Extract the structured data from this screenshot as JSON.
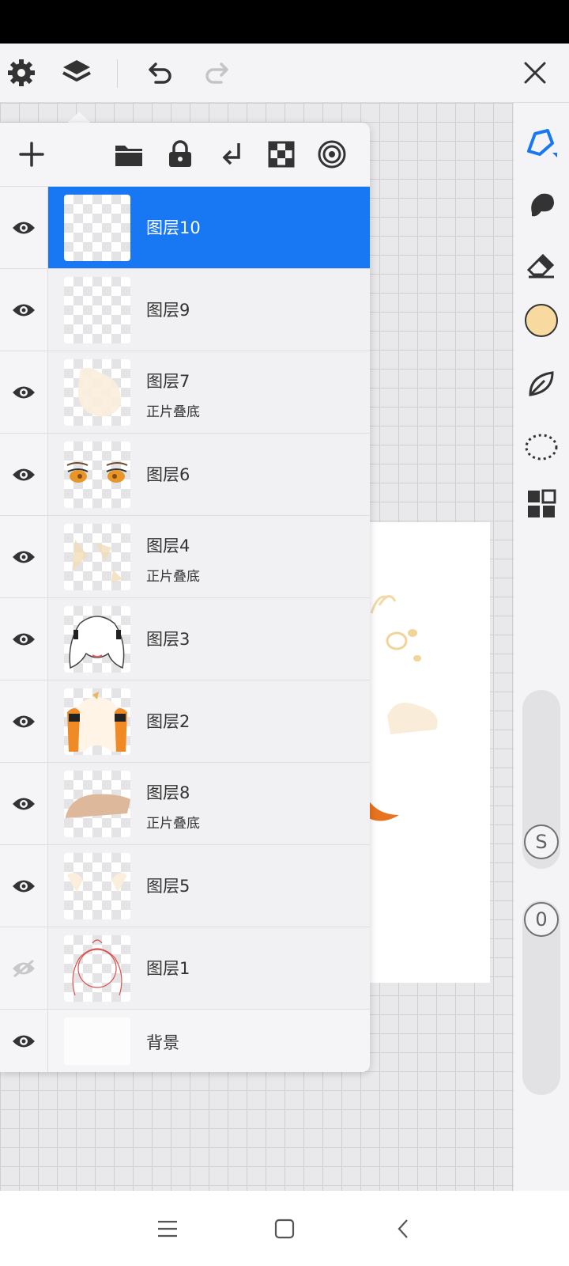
{
  "layers": [
    {
      "name": "图层10",
      "mode": "",
      "visible": true,
      "selected": true
    },
    {
      "name": "图层9",
      "mode": "",
      "visible": true,
      "selected": false
    },
    {
      "name": "图层7",
      "mode": "正片叠底",
      "visible": true,
      "selected": false
    },
    {
      "name": "图层6",
      "mode": "",
      "visible": true,
      "selected": false
    },
    {
      "name": "图层4",
      "mode": "正片叠底",
      "visible": true,
      "selected": false
    },
    {
      "name": "图层3",
      "mode": "",
      "visible": true,
      "selected": false
    },
    {
      "name": "图层2",
      "mode": "",
      "visible": true,
      "selected": false
    },
    {
      "name": "图层8",
      "mode": "正片叠底",
      "visible": true,
      "selected": false
    },
    {
      "name": "图层5",
      "mode": "",
      "visible": true,
      "selected": false
    },
    {
      "name": "图层1",
      "mode": "",
      "visible": false,
      "selected": false
    },
    {
      "name": "背景",
      "mode": "",
      "visible": true,
      "selected": false
    }
  ],
  "brush_size_label": "S",
  "opacity_label": "0",
  "colors": {
    "selected_layer": "#1877f2",
    "accent_tool": "#1877f2",
    "current_color": "#f8d9a0"
  },
  "icons": {
    "top_toolbar": [
      "gear-icon",
      "layers-icon",
      "undo-icon",
      "redo-icon",
      "close-icon"
    ],
    "layer_toolbar": [
      "add-layer-icon",
      "folder-icon",
      "lock-icon",
      "merge-down-icon",
      "checker-icon",
      "reference-icon"
    ],
    "right_toolbar": [
      "pen-icon",
      "smudge-icon",
      "eraser-icon",
      "color-swatch",
      "leaf-icon",
      "lasso-icon",
      "grid-icon"
    ],
    "nav": [
      "menu-icon",
      "home-icon",
      "back-icon"
    ]
  }
}
